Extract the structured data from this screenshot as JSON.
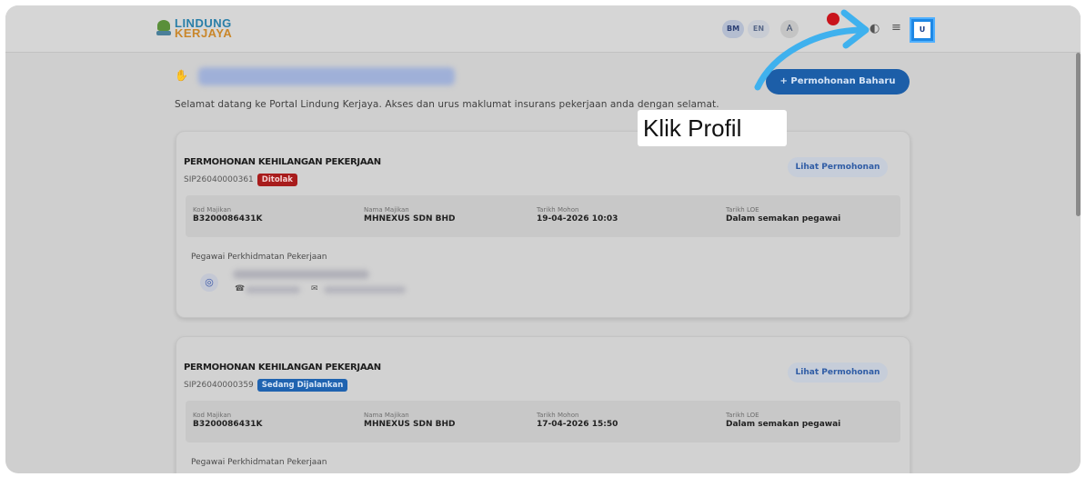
{
  "header": {
    "logo_line1": "LINDUNG",
    "logo_line2": "KERJAYA",
    "lang_bm": "BM",
    "lang_en": "EN",
    "font_btn": "A",
    "user_initial": "U"
  },
  "greeting": {
    "wave_icon": "waving-hand-icon",
    "welcome_text": "Selamat datang ke Portal Lindung Kerjaya. Akses dan urus maklumat insurans pekerjaan anda dengan selamat."
  },
  "new_application_label": "+ Permohonan Baharu",
  "callout_text": "Klik Profil",
  "cards": [
    {
      "title": "PERMOHONAN KEHILANGAN PEKERJAAN",
      "ref": "SIP26040000361",
      "status": "Ditolak",
      "view_label": "Lihat Permohonan",
      "fields": [
        {
          "label": "Kod Majikan",
          "value": "B3200086431K"
        },
        {
          "label": "Nama Majikan",
          "value": "MHNEXUS SDN BHD"
        },
        {
          "label": "Tarikh Mohon",
          "value": "19-04-2026 10:03"
        },
        {
          "label": "Tarikh LOE",
          "value": "Dalam semakan pegawai"
        }
      ],
      "officer_label": "Pegawai Perkhidmatan Pekerjaan"
    },
    {
      "title": "PERMOHONAN KEHILANGAN PEKERJAAN",
      "ref": "SIP26040000359",
      "status": "Sedang Dijalankan",
      "view_label": "Lihat Permohonan",
      "fields": [
        {
          "label": "Kod Majikan",
          "value": "B3200086431K"
        },
        {
          "label": "Nama Majikan",
          "value": "MHNEXUS SDN BHD"
        },
        {
          "label": "Tarikh Mohon",
          "value": "17-04-2026 15:50"
        },
        {
          "label": "Tarikh LOE",
          "value": "Dalam semakan pegawai"
        }
      ],
      "officer_label": "Pegawai Perkhidmatan Pekerjaan"
    }
  ],
  "colors": {
    "accent": "#1c5ea8",
    "status_rejected": "#a81c1c",
    "status_in_progress": "#1f63b0",
    "annotation_arrow": "#3fb1ee"
  }
}
